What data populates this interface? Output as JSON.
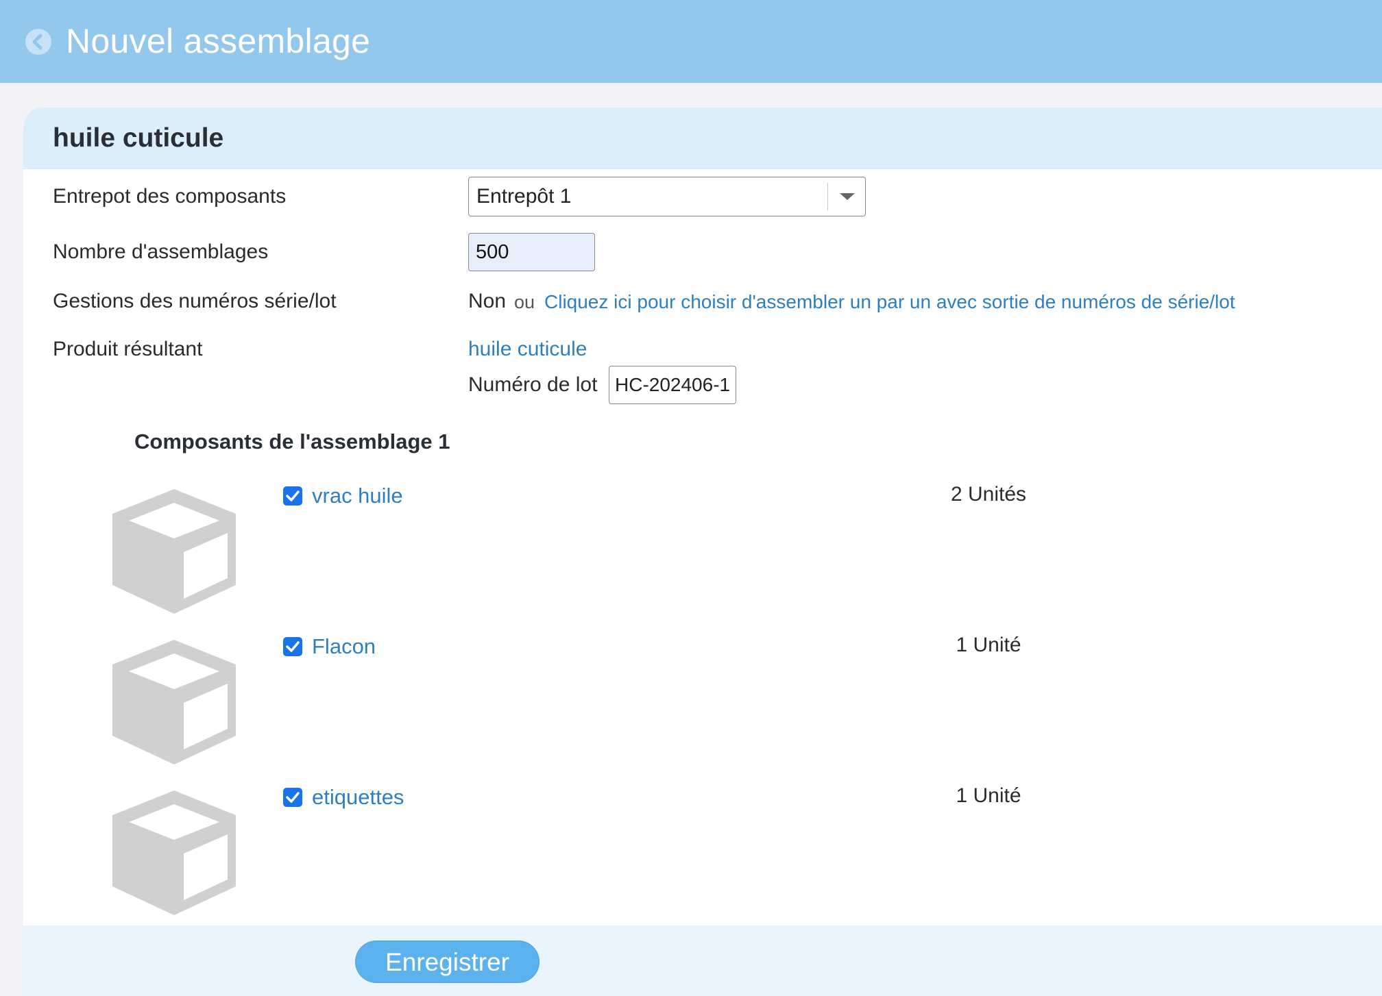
{
  "header": {
    "title": "Nouvel assemblage",
    "back_icon": "chevron-left-circle-icon"
  },
  "product": {
    "title": "huile cuticule"
  },
  "form": {
    "warehouse_label": "Entrepot des composants",
    "warehouse_value": "Entrepôt 1",
    "quantity_label": "Nombre d'assemblages",
    "quantity_value": "500",
    "serial_label": "Gestions des numéros série/lot",
    "serial_value": "Non",
    "serial_or": "ou",
    "serial_link": "Cliquez ici pour choisir d'assembler un par un avec sortie de numéros de série/lot",
    "result_label": "Produit résultant",
    "result_product": "huile cuticule",
    "lot_label": "Numéro de lot",
    "lot_value": "HC-202406-1"
  },
  "components": {
    "title": "Composants de l'assemblage 1",
    "items": [
      {
        "name": "vrac huile",
        "quantity": "2 Unités",
        "checked": true,
        "icon": "box-icon"
      },
      {
        "name": "Flacon",
        "quantity": "1 Unité",
        "checked": true,
        "icon": "box-icon"
      },
      {
        "name": "etiquettes",
        "quantity": "1 Unité",
        "checked": true,
        "icon": "box-icon"
      }
    ]
  },
  "footer": {
    "save_label": "Enregistrer"
  },
  "colors": {
    "header_bg": "#94c7ec",
    "card_head_bg": "#ddeefb",
    "link": "#2e7fc2",
    "button": "#5cb2ec",
    "checkbox": "#1a73e8"
  }
}
